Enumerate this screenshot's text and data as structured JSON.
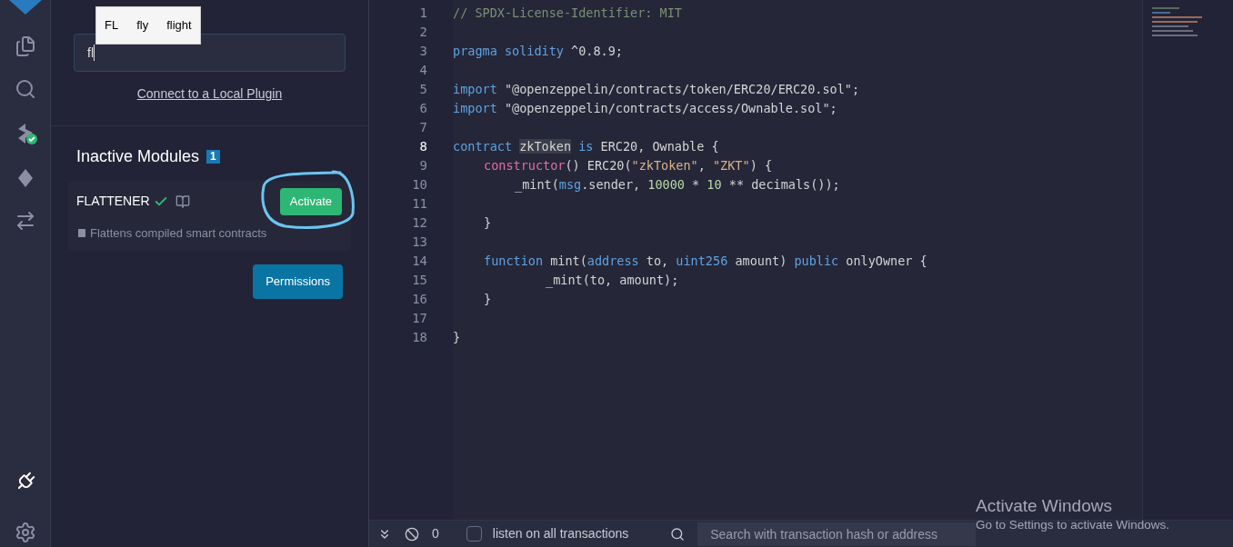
{
  "icon_bar": {
    "items": [
      {
        "kind": "files",
        "selected": false
      },
      {
        "kind": "search",
        "selected": false
      },
      {
        "kind": "compiler",
        "selected": false
      },
      {
        "kind": "deploy",
        "selected": false
      },
      {
        "kind": "plugin-link",
        "selected": false
      },
      {
        "kind": "plugins",
        "selected": true
      },
      {
        "kind": "settings",
        "selected": false
      }
    ]
  },
  "plugin_manager": {
    "search": {
      "value": "fl"
    },
    "autocomplete": [
      "FL",
      "fly",
      "flight"
    ],
    "local_plugin_link": "Connect to a Local Plugin",
    "section_title": "Inactive Modules",
    "section_count": "1",
    "modules": [
      {
        "name": "FLATTENER",
        "verified": true,
        "description": "Flattens compiled smart contracts",
        "action": "Activate"
      }
    ],
    "permissions_button": "Permissions"
  },
  "editor": {
    "lines": [
      {
        "number": "1",
        "current": false,
        "kind": "top",
        "tokens": [
          {
            "text": "// SPDX-License-Identifier: MIT",
            "kind": "comment"
          }
        ]
      },
      {
        "number": "2",
        "current": false,
        "kind": "blank"
      },
      {
        "number": "3",
        "current": false,
        "kind": "top",
        "tokens": [
          {
            "text": "pragma solidity",
            "kind": "keyword"
          },
          {
            "text": " ^0.8.9;",
            "kind": "plain"
          }
        ]
      },
      {
        "number": "4",
        "current": false,
        "kind": "blank"
      },
      {
        "number": "5",
        "current": false,
        "kind": "top",
        "tokens": [
          {
            "text": "import",
            "kind": "keyword"
          },
          {
            "text": " \"@openzeppelin/contracts/token/ERC20/ERC20.sol\";",
            "kind": "plain"
          }
        ]
      },
      {
        "number": "6",
        "current": false,
        "kind": "top",
        "tokens": [
          {
            "text": "import",
            "kind": "keyword"
          },
          {
            "text": " \"@openzeppelin/contracts/access/Ownable.sol\";",
            "kind": "plain"
          }
        ]
      },
      {
        "number": "7",
        "current": false,
        "kind": "blank"
      },
      {
        "number": "8",
        "current": true,
        "kind": "top",
        "tokens": [
          {
            "text": "contract ",
            "kind": "keyword"
          },
          {
            "text": "zkToken",
            "kind": "highlight"
          },
          {
            "text": " is",
            "kind": "keyword"
          },
          {
            "text": " ERC20, Ownable {",
            "kind": "plain"
          }
        ]
      },
      {
        "number": "9",
        "current": false,
        "kind": "member",
        "tokens": [
          {
            "text": "constructor",
            "kind": "special"
          },
          {
            "text": "() ERC20(",
            "kind": "plain"
          },
          {
            "text": "\"zkToken\"",
            "kind": "string"
          },
          {
            "text": ", ",
            "kind": "plain"
          },
          {
            "text": "\"ZKT\"",
            "kind": "string"
          },
          {
            "text": ") {",
            "kind": "plain"
          }
        ]
      },
      {
        "number": "10",
        "current": false,
        "kind": "statement",
        "tokens": [
          {
            "text": "_mint(",
            "kind": "plain"
          },
          {
            "text": "msg",
            "kind": "keyword"
          },
          {
            "text": ".sender, ",
            "kind": "plain"
          },
          {
            "text": "10000",
            "kind": "number"
          },
          {
            "text": " * ",
            "kind": "plain"
          },
          {
            "text": "10",
            "kind": "number"
          },
          {
            "text": " ** decimals());",
            "kind": "plain"
          }
        ]
      },
      {
        "number": "11",
        "current": false,
        "kind": "blank"
      },
      {
        "number": "12",
        "current": false,
        "kind": "member",
        "tokens": [
          {
            "text": "}",
            "kind": "plain"
          }
        ]
      },
      {
        "number": "13",
        "current": false,
        "kind": "blank"
      },
      {
        "number": "14",
        "current": false,
        "kind": "member",
        "tokens": [
          {
            "text": "function",
            "kind": "keyword"
          },
          {
            "text": " mint(",
            "kind": "plain"
          },
          {
            "text": "address",
            "kind": "keyword"
          },
          {
            "text": " to, ",
            "kind": "plain"
          },
          {
            "text": "uint256",
            "kind": "keyword"
          },
          {
            "text": " amount) ",
            "kind": "plain"
          },
          {
            "text": "public",
            "kind": "keyword"
          },
          {
            "text": " onlyOwner {",
            "kind": "plain"
          }
        ]
      },
      {
        "number": "15",
        "current": false,
        "kind": "deep",
        "tokens": [
          {
            "text": "_mint(to, amount);",
            "kind": "plain"
          }
        ]
      },
      {
        "number": "16",
        "current": false,
        "kind": "member",
        "tokens": [
          {
            "text": "}",
            "kind": "plain"
          }
        ]
      },
      {
        "number": "17",
        "current": false,
        "kind": "blank"
      },
      {
        "number": "18",
        "current": false,
        "kind": "top",
        "tokens": [
          {
            "text": "}",
            "kind": "plain"
          }
        ]
      }
    ]
  },
  "terminal_bar": {
    "counter": "0",
    "listen_label": "listen on all transactions",
    "listen_checked": false,
    "search_placeholder": "Search with transaction hash or address"
  },
  "os_notice": {
    "title": "Activate Windows",
    "subtitle": "Go to Settings to activate Windows."
  }
}
